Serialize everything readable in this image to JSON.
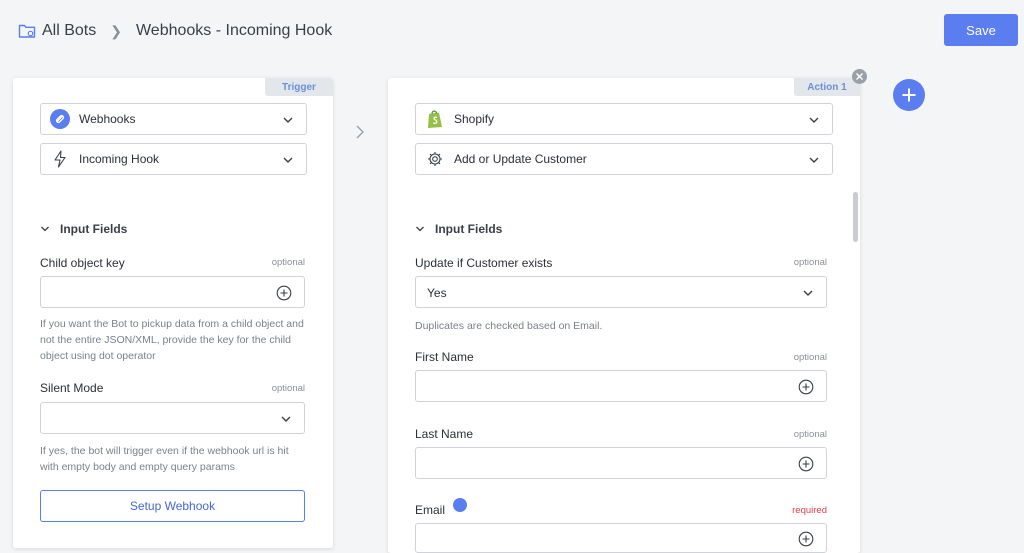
{
  "breadcrumb": {
    "root": "All Bots",
    "current": "Webhooks - Incoming Hook"
  },
  "toolbar": {
    "save_label": "Save"
  },
  "colors": {
    "accent": "#5a7df0",
    "required": "#e0424b",
    "shopify": "#95bf47"
  },
  "trigger": {
    "tag": "Trigger",
    "app": {
      "label": "Webhooks",
      "icon": "link-icon"
    },
    "event": {
      "label": "Incoming Hook",
      "icon": "lightning-icon"
    },
    "section_title": "Input Fields",
    "fields": [
      {
        "label": "Child object key",
        "flag": "optional",
        "value": "",
        "help": "If you want the Bot to pickup data from a child object and not the entire JSON/XML, provide the key for the child object using dot operator"
      },
      {
        "label": "Silent Mode",
        "flag": "optional",
        "value": "",
        "help": "If yes, the bot will trigger even if the webhook url is hit with empty body and empty query params"
      }
    ],
    "setup_label": "Setup Webhook"
  },
  "action": {
    "tag": "Action 1",
    "app": {
      "label": "Shopify",
      "icon": "shopify-icon"
    },
    "event": {
      "label": "Add or Update Customer",
      "icon": "gear-icon"
    },
    "section_title": "Input Fields",
    "fields": [
      {
        "label": "Update if Customer exists",
        "flag": "optional",
        "value": "Yes",
        "help": "Duplicates are checked based on Email."
      },
      {
        "label": "First Name",
        "flag": "optional",
        "value": ""
      },
      {
        "label": "Last Name",
        "flag": "optional",
        "value": ""
      },
      {
        "label": "Email",
        "flag": "required",
        "value": ""
      }
    ]
  }
}
